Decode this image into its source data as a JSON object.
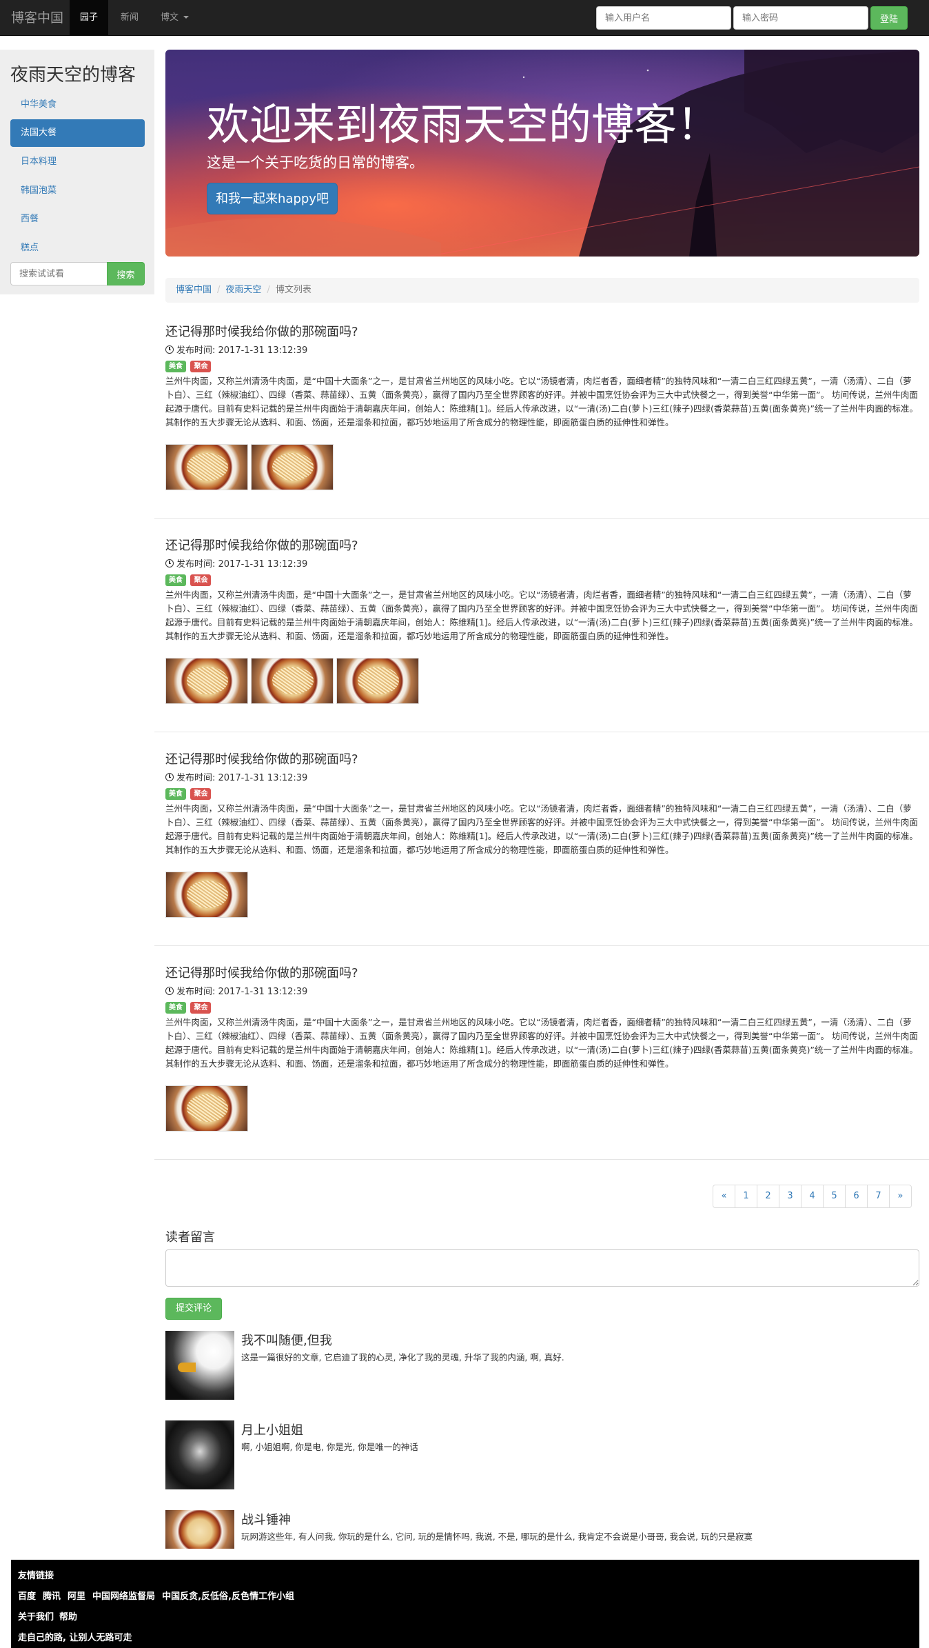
{
  "navbar": {
    "brand": "博客中国",
    "items": [
      {
        "label": "园子",
        "active": true
      },
      {
        "label": "新闻",
        "active": false
      },
      {
        "label": "博文",
        "active": false
      }
    ],
    "username_placeholder": "输入用户名",
    "password_placeholder": "输入密码",
    "login_label": "登陆"
  },
  "sidebar": {
    "title": "夜雨天空的博客",
    "items": [
      {
        "label": "中华美食",
        "active": false
      },
      {
        "label": "法国大餐",
        "active": true
      },
      {
        "label": "日本料理",
        "active": false
      },
      {
        "label": "韩国泡菜",
        "active": false
      },
      {
        "label": "西餐",
        "active": false
      },
      {
        "label": "糕点",
        "active": false
      }
    ],
    "search_placeholder": "搜索试试看",
    "search_label": "搜索"
  },
  "jumbotron": {
    "title": "欢迎来到夜雨天空的博客！",
    "subtitle": "这是一个关于吃货的日常的博客。",
    "button_label": "和我一起来happy吧"
  },
  "breadcrumb": {
    "items": [
      "博客中国",
      "夜雨天空",
      "博文列表"
    ]
  },
  "posts": [
    {
      "title": "还记得那时候我给你做的那碗面吗?",
      "time": "发布时间: 2017-1-31 13:12:39",
      "tags": [
        "美食",
        "聚会"
      ],
      "body": "兰州牛肉面，又称兰州清汤牛肉面，是“中国十大面条”之一，是甘肃省兰州地区的风味小吃。它以“汤镜者清，肉烂者香，面细者精”的独特风味和“一清二白三红四绿五黄”，一清（汤清）、二白（萝卜白）、三红（辣椒油红）、四绿（香菜、蒜苗绿）、五黄（面条黄亮），赢得了国内乃至全世界顾客的好评。并被中国烹饪协会评为三大中式快餐之一，得到美誉“中华第一面”。 坊间传说，兰州牛肉面起源于唐代。目前有史料记载的是兰州牛肉面始于清朝嘉庆年间，创始人：陈维精[1]。经后人传承改进，以“一清(汤)二白(萝卜)三红(辣子)四绿(香菜蒜苗)五黄(面条黄亮)”统一了兰州牛肉面的标准。其制作的五大步骤无论从选料、和面、饧面，还是溜条和拉面，都巧妙地运用了所含成分的物理性能，即面筋蛋白质的延伸性和弹性。",
      "image_count": 2
    },
    {
      "title": "还记得那时候我给你做的那碗面吗?",
      "time": "发布时间: 2017-1-31 13:12:39",
      "tags": [
        "美食",
        "聚会"
      ],
      "body": "兰州牛肉面，又称兰州清汤牛肉面，是“中国十大面条”之一，是甘肃省兰州地区的风味小吃。它以“汤镜者清，肉烂者香，面细者精”的独特风味和“一清二白三红四绿五黄”，一清（汤清）、二白（萝卜白）、三红（辣椒油红）、四绿（香菜、蒜苗绿）、五黄（面条黄亮），赢得了国内乃至全世界顾客的好评。并被中国烹饪协会评为三大中式快餐之一，得到美誉“中华第一面”。 坊间传说，兰州牛肉面起源于唐代。目前有史料记载的是兰州牛肉面始于清朝嘉庆年间，创始人：陈维精[1]。经后人传承改进，以“一清(汤)二白(萝卜)三红(辣子)四绿(香菜蒜苗)五黄(面条黄亮)”统一了兰州牛肉面的标准。其制作的五大步骤无论从选料、和面、饧面，还是溜条和拉面，都巧妙地运用了所含成分的物理性能，即面筋蛋白质的延伸性和弹性。",
      "image_count": 3
    },
    {
      "title": "还记得那时候我给你做的那碗面吗?",
      "time": "发布时间: 2017-1-31 13:12:39",
      "tags": [
        "美食",
        "聚会"
      ],
      "body": "兰州牛肉面，又称兰州清汤牛肉面，是“中国十大面条”之一，是甘肃省兰州地区的风味小吃。它以“汤镜者清，肉烂者香，面细者精”的独特风味和“一清二白三红四绿五黄”，一清（汤清）、二白（萝卜白）、三红（辣椒油红）、四绿（香菜、蒜苗绿）、五黄（面条黄亮），赢得了国内乃至全世界顾客的好评。并被中国烹饪协会评为三大中式快餐之一，得到美誉“中华第一面”。 坊间传说，兰州牛肉面起源于唐代。目前有史料记载的是兰州牛肉面始于清朝嘉庆年间，创始人：陈维精[1]。经后人传承改进，以“一清(汤)二白(萝卜)三红(辣子)四绿(香菜蒜苗)五黄(面条黄亮)”统一了兰州牛肉面的标准。其制作的五大步骤无论从选料、和面、饧面，还是溜条和拉面，都巧妙地运用了所含成分的物理性能，即面筋蛋白质的延伸性和弹性。",
      "image_count": 1
    },
    {
      "title": "还记得那时候我给你做的那碗面吗?",
      "time": "发布时间: 2017-1-31 13:12:39",
      "tags": [
        "美食",
        "聚会"
      ],
      "body": "兰州牛肉面，又称兰州清汤牛肉面，是“中国十大面条”之一，是甘肃省兰州地区的风味小吃。它以“汤镜者清，肉烂者香，面细者精”的独特风味和“一清二白三红四绿五黄”，一清（汤清）、二白（萝卜白）、三红（辣椒油红）、四绿（香菜、蒜苗绿）、五黄（面条黄亮），赢得了国内乃至全世界顾客的好评。并被中国烹饪协会评为三大中式快餐之一，得到美誉“中华第一面”。 坊间传说，兰州牛肉面起源于唐代。目前有史料记载的是兰州牛肉面始于清朝嘉庆年间，创始人：陈维精[1]。经后人传承改进，以“一清(汤)二白(萝卜)三红(辣子)四绿(香菜蒜苗)五黄(面条黄亮)”统一了兰州牛肉面的标准。其制作的五大步骤无论从选料、和面、饧面，还是溜条和拉面，都巧妙地运用了所含成分的物理性能，即面筋蛋白质的延伸性和弹性。",
      "image_count": 1
    }
  ],
  "pagination": [
    "«",
    "1",
    "2",
    "3",
    "4",
    "5",
    "6",
    "7",
    "»"
  ],
  "comments_section": {
    "title": "读者留言",
    "submit_label": "提交评论",
    "comments": [
      {
        "name": "我不叫随便,但我",
        "text": "这是一篇很好的文章, 它启迪了我的心灵, 净化了我的灵魂, 升华了我的内涵, 啊, 真好.",
        "avatar": "eagle-avatar"
      },
      {
        "name": "月上小姐姐",
        "text": "啊, 小姐姐啊, 你是电, 你是光, 你是唯一的神话",
        "avatar": "person-avatar"
      },
      {
        "name": "战斗锤神",
        "text": "玩网游这些年, 有人问我, 你玩的是什么, 它问, 玩的是情怀吗, 我说, 不是, 哪玩的是什么, 我肯定不会说是小哥哥, 我会说, 玩的只是寂寞",
        "avatar": "noodle-avatar"
      }
    ]
  },
  "footer": {
    "title": "友情链接",
    "links": [
      "百度",
      "腾讯",
      "阿里",
      "中国网络监督局",
      "中国反贪,反低俗,反色情工作小组"
    ],
    "about": [
      "关于我们",
      "帮助"
    ],
    "motto": "走自己的路, 让别人无路可走"
  },
  "colors": {
    "primary": "#337ab7",
    "success": "#5cb85c",
    "danger": "#d9534f",
    "navbar": "#222222"
  }
}
